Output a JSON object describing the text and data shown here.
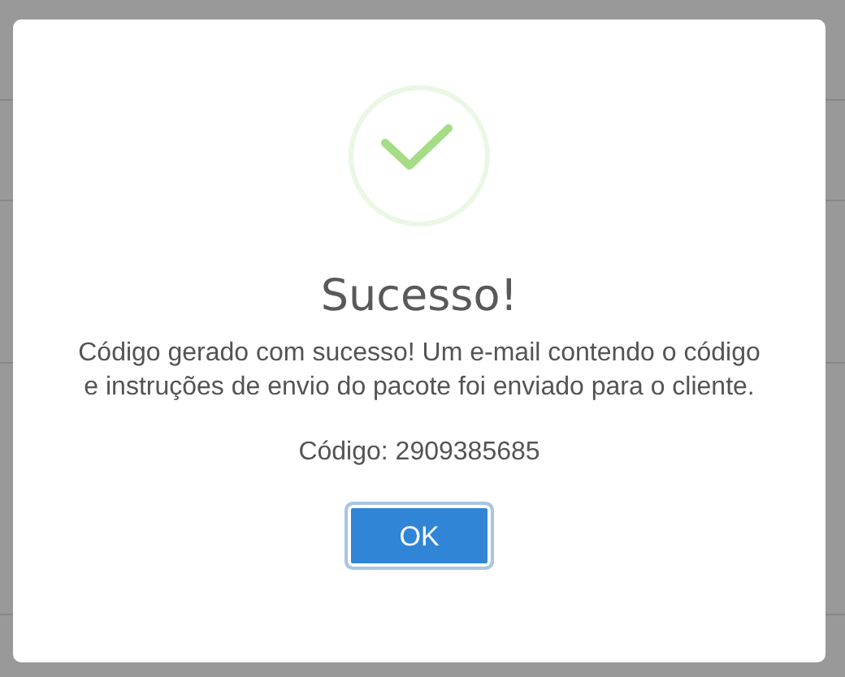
{
  "dialog": {
    "icon": {
      "kind": "success"
    },
    "title": "Sucesso!",
    "message": "Código gerado com sucesso! Um e-mail contendo o código e instruções de envio do pacote foi enviado para o cliente.",
    "code_line": "Código: 2909385685",
    "buttons": [
      {
        "label": "OK",
        "focused": true
      }
    ]
  }
}
